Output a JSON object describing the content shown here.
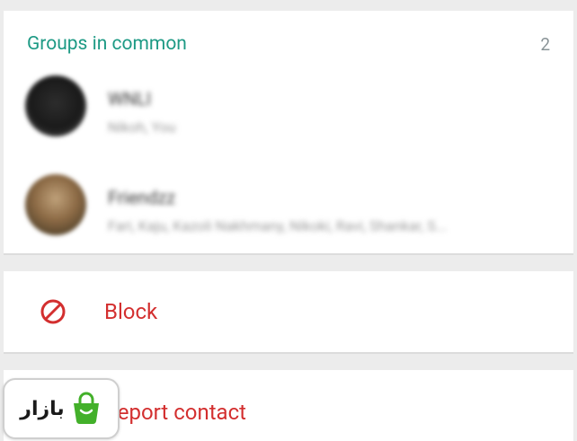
{
  "groups_section": {
    "title": "Groups in common",
    "count": "2",
    "groups": [
      {
        "name": "WNLI",
        "members": "Nikoh, You"
      },
      {
        "name": "Friendzz",
        "members": "Fari, Kaju, Kazoli Nakhmany, Nikoki, Ravi, Shankar, S..."
      }
    ]
  },
  "actions": {
    "block_label": "Block",
    "report_label": "Report contact"
  },
  "badge": {
    "label": "بازار"
  },
  "colors": {
    "accent": "#1e9a85",
    "danger": "#d32f2f",
    "badge_green": "#43b02a"
  }
}
